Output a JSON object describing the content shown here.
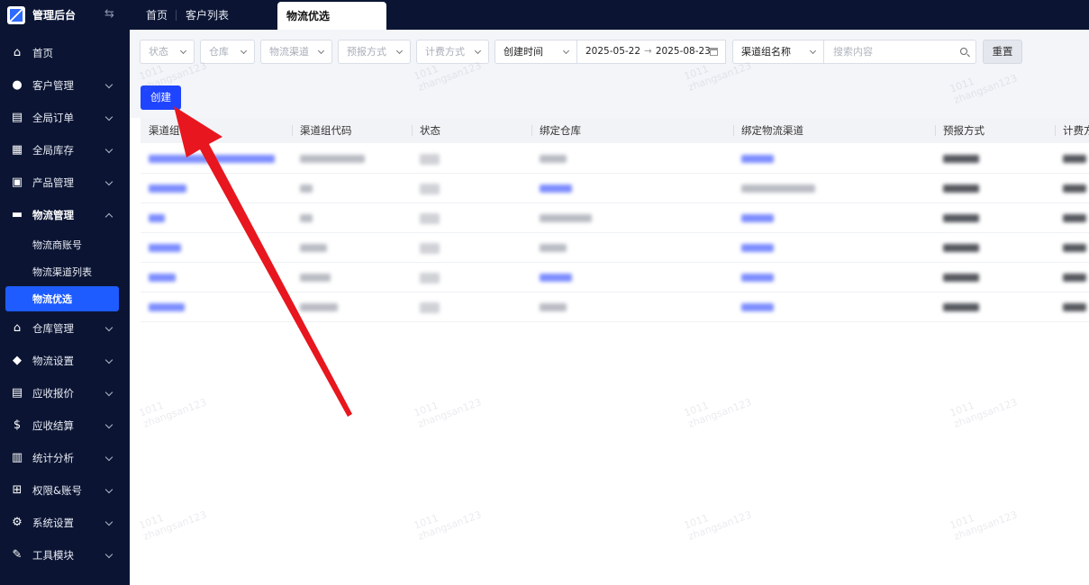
{
  "brand": {
    "title": "管理后台",
    "toggle_icon": "⇆"
  },
  "tabs": [
    {
      "label": "首页"
    },
    {
      "label": "客户列表"
    },
    {
      "label": "物流优选",
      "active": true
    }
  ],
  "sidebar": {
    "items": [
      {
        "label": "首页",
        "icon": "home-icon"
      },
      {
        "label": "客户管理",
        "icon": "users-icon"
      },
      {
        "label": "全局订单",
        "icon": "clipboard-icon"
      },
      {
        "label": "全局库存",
        "icon": "warehouse-icon"
      },
      {
        "label": "产品管理",
        "icon": "box-icon"
      },
      {
        "label": "物流管理",
        "icon": "truck-icon",
        "open": true,
        "children": [
          {
            "label": "物流商账号"
          },
          {
            "label": "物流渠道列表"
          },
          {
            "label": "物流优选",
            "active": true
          }
        ]
      },
      {
        "label": "仓库管理",
        "icon": "store-icon"
      },
      {
        "label": "物流设置",
        "icon": "cube-icon"
      },
      {
        "label": "应收报价",
        "icon": "document-icon"
      },
      {
        "label": "应收结算",
        "icon": "dollar-icon"
      },
      {
        "label": "统计分析",
        "icon": "chart-icon"
      },
      {
        "label": "权限&账号",
        "icon": "org-icon"
      },
      {
        "label": "系统设置",
        "icon": "gear-icon"
      },
      {
        "label": "工具模块",
        "icon": "wrench-icon"
      }
    ]
  },
  "filters": {
    "status": "状态",
    "warehouse": "仓库",
    "channel": "物流渠道",
    "forecast": "预报方式",
    "billing": "计费方式",
    "date_type": "创建时间",
    "date_start": "2025-05-22",
    "date_sep": "→",
    "date_end": "2025-08-23",
    "search_field": "渠道组名称",
    "search_placeholder": "搜索内容",
    "reset": "重置"
  },
  "toolbar": {
    "create": "创建"
  },
  "table": {
    "columns": [
      "渠道组名称",
      "渠道组代码",
      "状态",
      "绑定仓库",
      "绑定物流渠道",
      "预报方式",
      "计费方式"
    ]
  },
  "watermark": {
    "line1": "1011",
    "line2": "zhangsan123"
  },
  "colors": {
    "sidebar_bg": "#0b1533",
    "primary": "#1f44ff",
    "active_menu": "#1e5cff",
    "arrow": "#e8161e"
  }
}
